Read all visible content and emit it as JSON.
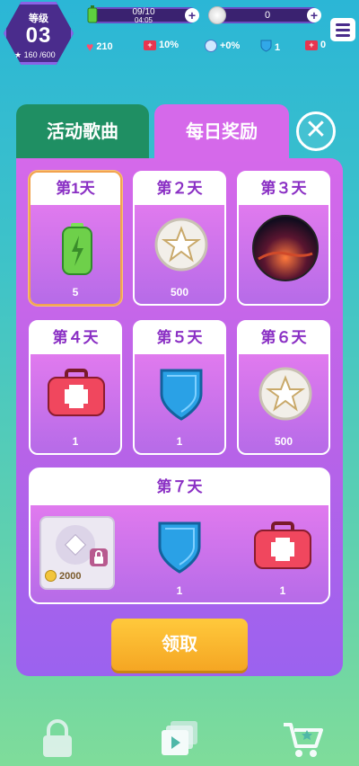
{
  "hud": {
    "level_label": "等级",
    "level_value": "03",
    "xp": "160 /600",
    "date": "09/10",
    "time": "04:05",
    "coins": "0",
    "stats": [
      {
        "icon": "heart-icon",
        "value": "210"
      },
      {
        "icon": "medkit-icon",
        "value": "10%"
      },
      {
        "icon": "boost-icon",
        "value": "+0%"
      },
      {
        "icon": "shield-icon",
        "value": "1"
      },
      {
        "icon": "medkit-icon",
        "value": "0"
      }
    ]
  },
  "tabs": {
    "active_songs": "活动歌曲",
    "daily_rewards": "每日奖励"
  },
  "days": [
    {
      "label": "第1天",
      "qty": "5",
      "icon": "battery-icon",
      "selected": true
    },
    {
      "label": "第２天",
      "qty": "500",
      "icon": "star-coin-icon"
    },
    {
      "label": "第３天",
      "qty": "",
      "icon": "album-cover-icon"
    },
    {
      "label": "第４天",
      "qty": "1",
      "icon": "medkit-icon"
    },
    {
      "label": "第５天",
      "qty": "1",
      "icon": "shield-icon"
    },
    {
      "label": "第６天",
      "qty": "500",
      "icon": "star-coin-icon"
    }
  ],
  "day7": {
    "label": "第７天",
    "items": [
      {
        "icon": "locked-album-icon",
        "qty": "2000"
      },
      {
        "icon": "shield-icon",
        "qty": "1"
      },
      {
        "icon": "medkit-icon",
        "qty": "1"
      }
    ]
  },
  "claim_label": "领取",
  "colors": {
    "accent": "#d569ea",
    "claim": "#f5a623",
    "tab_inactive": "#1f8f63"
  }
}
